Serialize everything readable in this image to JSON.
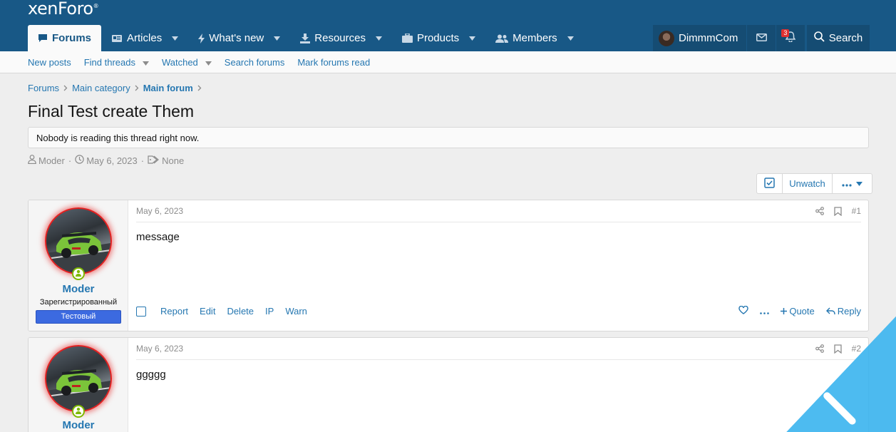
{
  "logo": {
    "text": "xenForo",
    "mark": "®"
  },
  "nav": {
    "tabs": [
      {
        "label": "Forums",
        "icon": "comments-icon",
        "active": true
      },
      {
        "label": "Articles",
        "icon": "newspaper-icon"
      },
      {
        "label": "What's new",
        "icon": "bolt-icon"
      },
      {
        "label": "Resources",
        "icon": "download-icon"
      },
      {
        "label": "Products",
        "icon": "briefcase-icon"
      },
      {
        "label": "Members",
        "icon": "users-icon"
      }
    ],
    "user": {
      "name": "DimmmCom",
      "alerts_count": "3"
    },
    "search_label": "Search"
  },
  "subnav": {
    "new_posts": "New posts",
    "find_threads": "Find threads",
    "watched": "Watched",
    "search_forums": "Search forums",
    "mark_read": "Mark forums read"
  },
  "breadcrumb": {
    "items": [
      "Forums",
      "Main category",
      "Main forum"
    ]
  },
  "thread": {
    "title": "Final Test create Them",
    "notice": "Nobody is reading this thread right now.",
    "author": "Moder",
    "date": "May 6, 2023",
    "tags": "None"
  },
  "thread_actions": {
    "unwatch": "Unwatch"
  },
  "posts": [
    {
      "username": "Moder",
      "user_title": "Зарегистрированный",
      "banner": "Тестовый",
      "date": "May 6, 2023",
      "number": "#1",
      "message": "message",
      "actions": {
        "report": "Report",
        "edit": "Edit",
        "delete": "Delete",
        "ip": "IP",
        "warn": "Warn",
        "quote": "Quote",
        "reply": "Reply"
      }
    },
    {
      "username": "Moder",
      "date": "May 6, 2023",
      "number": "#2",
      "message": "ggggg"
    }
  ],
  "colors": {
    "header": "#185886",
    "link": "#2577b1",
    "online": "#7fb900",
    "banner": "#3c6ae0"
  }
}
